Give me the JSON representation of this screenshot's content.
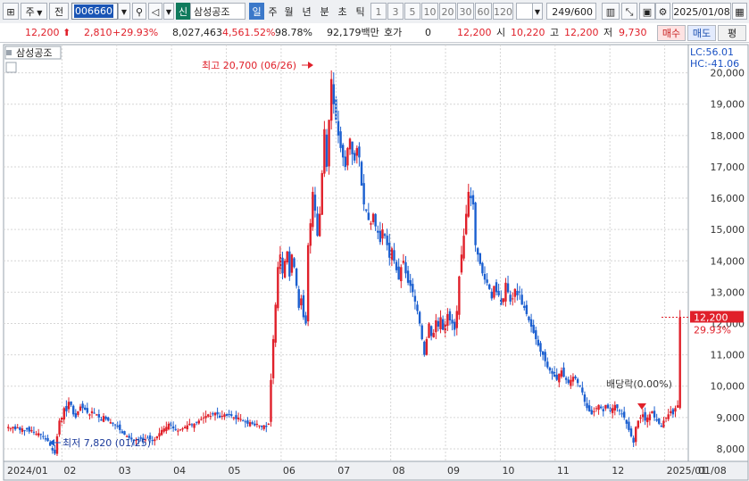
{
  "toolbar": {
    "market_type": "주",
    "period_label": "전",
    "stock_code": "006660",
    "company_badge": "신",
    "company_name": "삼성공조",
    "period_tabs": [
      "일",
      "주",
      "월",
      "년",
      "분",
      "초",
      "틱"
    ],
    "active_tab": "일",
    "intervals": [
      "1",
      "3",
      "5",
      "10",
      "20",
      "30",
      "60",
      "120"
    ],
    "count_display": "249/600",
    "date": "2025/01/08"
  },
  "info": {
    "price": "12,200",
    "change": "2,810",
    "change_pct": "+29.93%",
    "volume": "8,027,463",
    "volume_ratio": "4,561.52%",
    "turnover": "98.78%",
    "amount": "92,179백만",
    "hoga_label": "호가",
    "hoga_value": "0",
    "hoga_price": "12,200",
    "open_label": "시",
    "open": "10,220",
    "high_label": "고",
    "high": "12,200",
    "low_label": "저",
    "low": "9,730",
    "buy_label": "매수",
    "sell_label": "매도",
    "avg_label": "평"
  },
  "legend": {
    "name": "삼성공조",
    "lc": "LC:56.01",
    "hc": "HC:-41.06"
  },
  "annotations": {
    "high": "최고 20,700 (06/26)",
    "low": "최저 7,820 (01/25)",
    "dividend": "배당락(0.00%)",
    "price_tag": "12,200",
    "pct_tag": "29.93%"
  },
  "colors": {
    "up": "#e0202a",
    "down": "#1b5fd0",
    "grid": "#d6d6d6"
  },
  "chart_data": {
    "type": "candlestick",
    "yticks": [
      8000,
      9000,
      10000,
      11000,
      12000,
      13000,
      14000,
      15000,
      16000,
      17000,
      18000,
      19000,
      20000
    ],
    "ylim": [
      7600,
      20900
    ],
    "months": [
      "2024/01",
      "02",
      "03",
      "04",
      "05",
      "06",
      "07",
      "08",
      "09",
      "10",
      "11",
      "12",
      "2025/01",
      "01/08"
    ],
    "close": [
      8700,
      8650,
      8700,
      8620,
      8680,
      8600,
      8650,
      8580,
      8620,
      8550,
      8600,
      8520,
      8480,
      8500,
      8450,
      8380,
      8300,
      8250,
      8100,
      7950,
      7850,
      8400,
      8900,
      9000,
      9300,
      9200,
      9500,
      9400,
      9100,
      9000,
      9200,
      9350,
      9300,
      9250,
      9150,
      9100,
      9200,
      9150,
      9100,
      9000,
      8900,
      9050,
      8950,
      8900,
      8850,
      8800,
      8750,
      8700,
      8600,
      8500,
      8450,
      8400,
      8350,
      8300,
      8250,
      8280,
      8300,
      8320,
      8280,
      8300,
      8350,
      8300,
      8250,
      8300,
      8400,
      8500,
      8600,
      8650,
      8700,
      8800,
      8750,
      8650,
      8600,
      8580,
      8620,
      8650,
      8700,
      8750,
      8800,
      8750,
      8800,
      8850,
      8900,
      8950,
      9000,
      9050,
      9100,
      9050,
      9100,
      9150,
      9100,
      9000,
      9050,
      9100,
      9050,
      9100,
      9050,
      9000,
      8950,
      9000,
      8950,
      8900,
      8850,
      8800,
      8850,
      8800,
      8750,
      8800,
      8750,
      8700,
      8750,
      8700,
      8800,
      10200,
      11500,
      12600,
      13800,
      14200,
      13600,
      14000,
      14300,
      13500,
      14200,
      13800,
      13200,
      12500,
      12800,
      12200,
      12000,
      14500,
      15200,
      16200,
      15600,
      14800,
      15500,
      16800,
      18200,
      17000,
      18500,
      19800,
      19000,
      18500,
      18000,
      17600,
      17300,
      17000,
      17600,
      17900,
      17400,
      17200,
      17600,
      17300,
      16400,
      15800,
      15600,
      15300,
      15200,
      15500,
      15100,
      14900,
      14600,
      15000,
      14800,
      14500,
      14100,
      14400,
      14000,
      13700,
      13400,
      13800,
      14000,
      13600,
      13300,
      13200,
      13000,
      12700,
      12400,
      12000,
      11500,
      11000,
      11500,
      12000,
      11600,
      11700,
      12100,
      11900,
      12200,
      11800,
      12000,
      12300,
      12100,
      12000,
      11800,
      12400,
      13500,
      14200,
      14800,
      15500,
      16200,
      16000,
      15800,
      14500,
      14200,
      13900,
      13600,
      13400,
      13300,
      13100,
      12800,
      13200,
      13000,
      12900,
      12600,
      12800,
      13300,
      13000,
      12700,
      12800,
      13100,
      12900,
      13000,
      12600,
      12500,
      12300,
      12100,
      11900,
      11700,
      11500,
      11300,
      11100,
      11000,
      10800,
      10600,
      10500,
      10400,
      10300,
      10200,
      10400,
      10500,
      10300,
      10200,
      10100,
      10200,
      10300,
      10250,
      10100,
      10000,
      9800,
      9500,
      9300,
      9200,
      9100,
      9200,
      9300,
      9400,
      9300,
      9200,
      9400,
      9300,
      9200,
      9300,
      9400,
      9300,
      9200,
      9100,
      9000,
      8800,
      8600,
      8400,
      8200,
      8700,
      8900,
      9000,
      9100,
      8900,
      9000,
      9100,
      9200,
      9000,
      8900,
      8800,
      8700,
      8900,
      9000,
      9100,
      9200,
      9100,
      9300,
      9390,
      12200
    ]
  }
}
